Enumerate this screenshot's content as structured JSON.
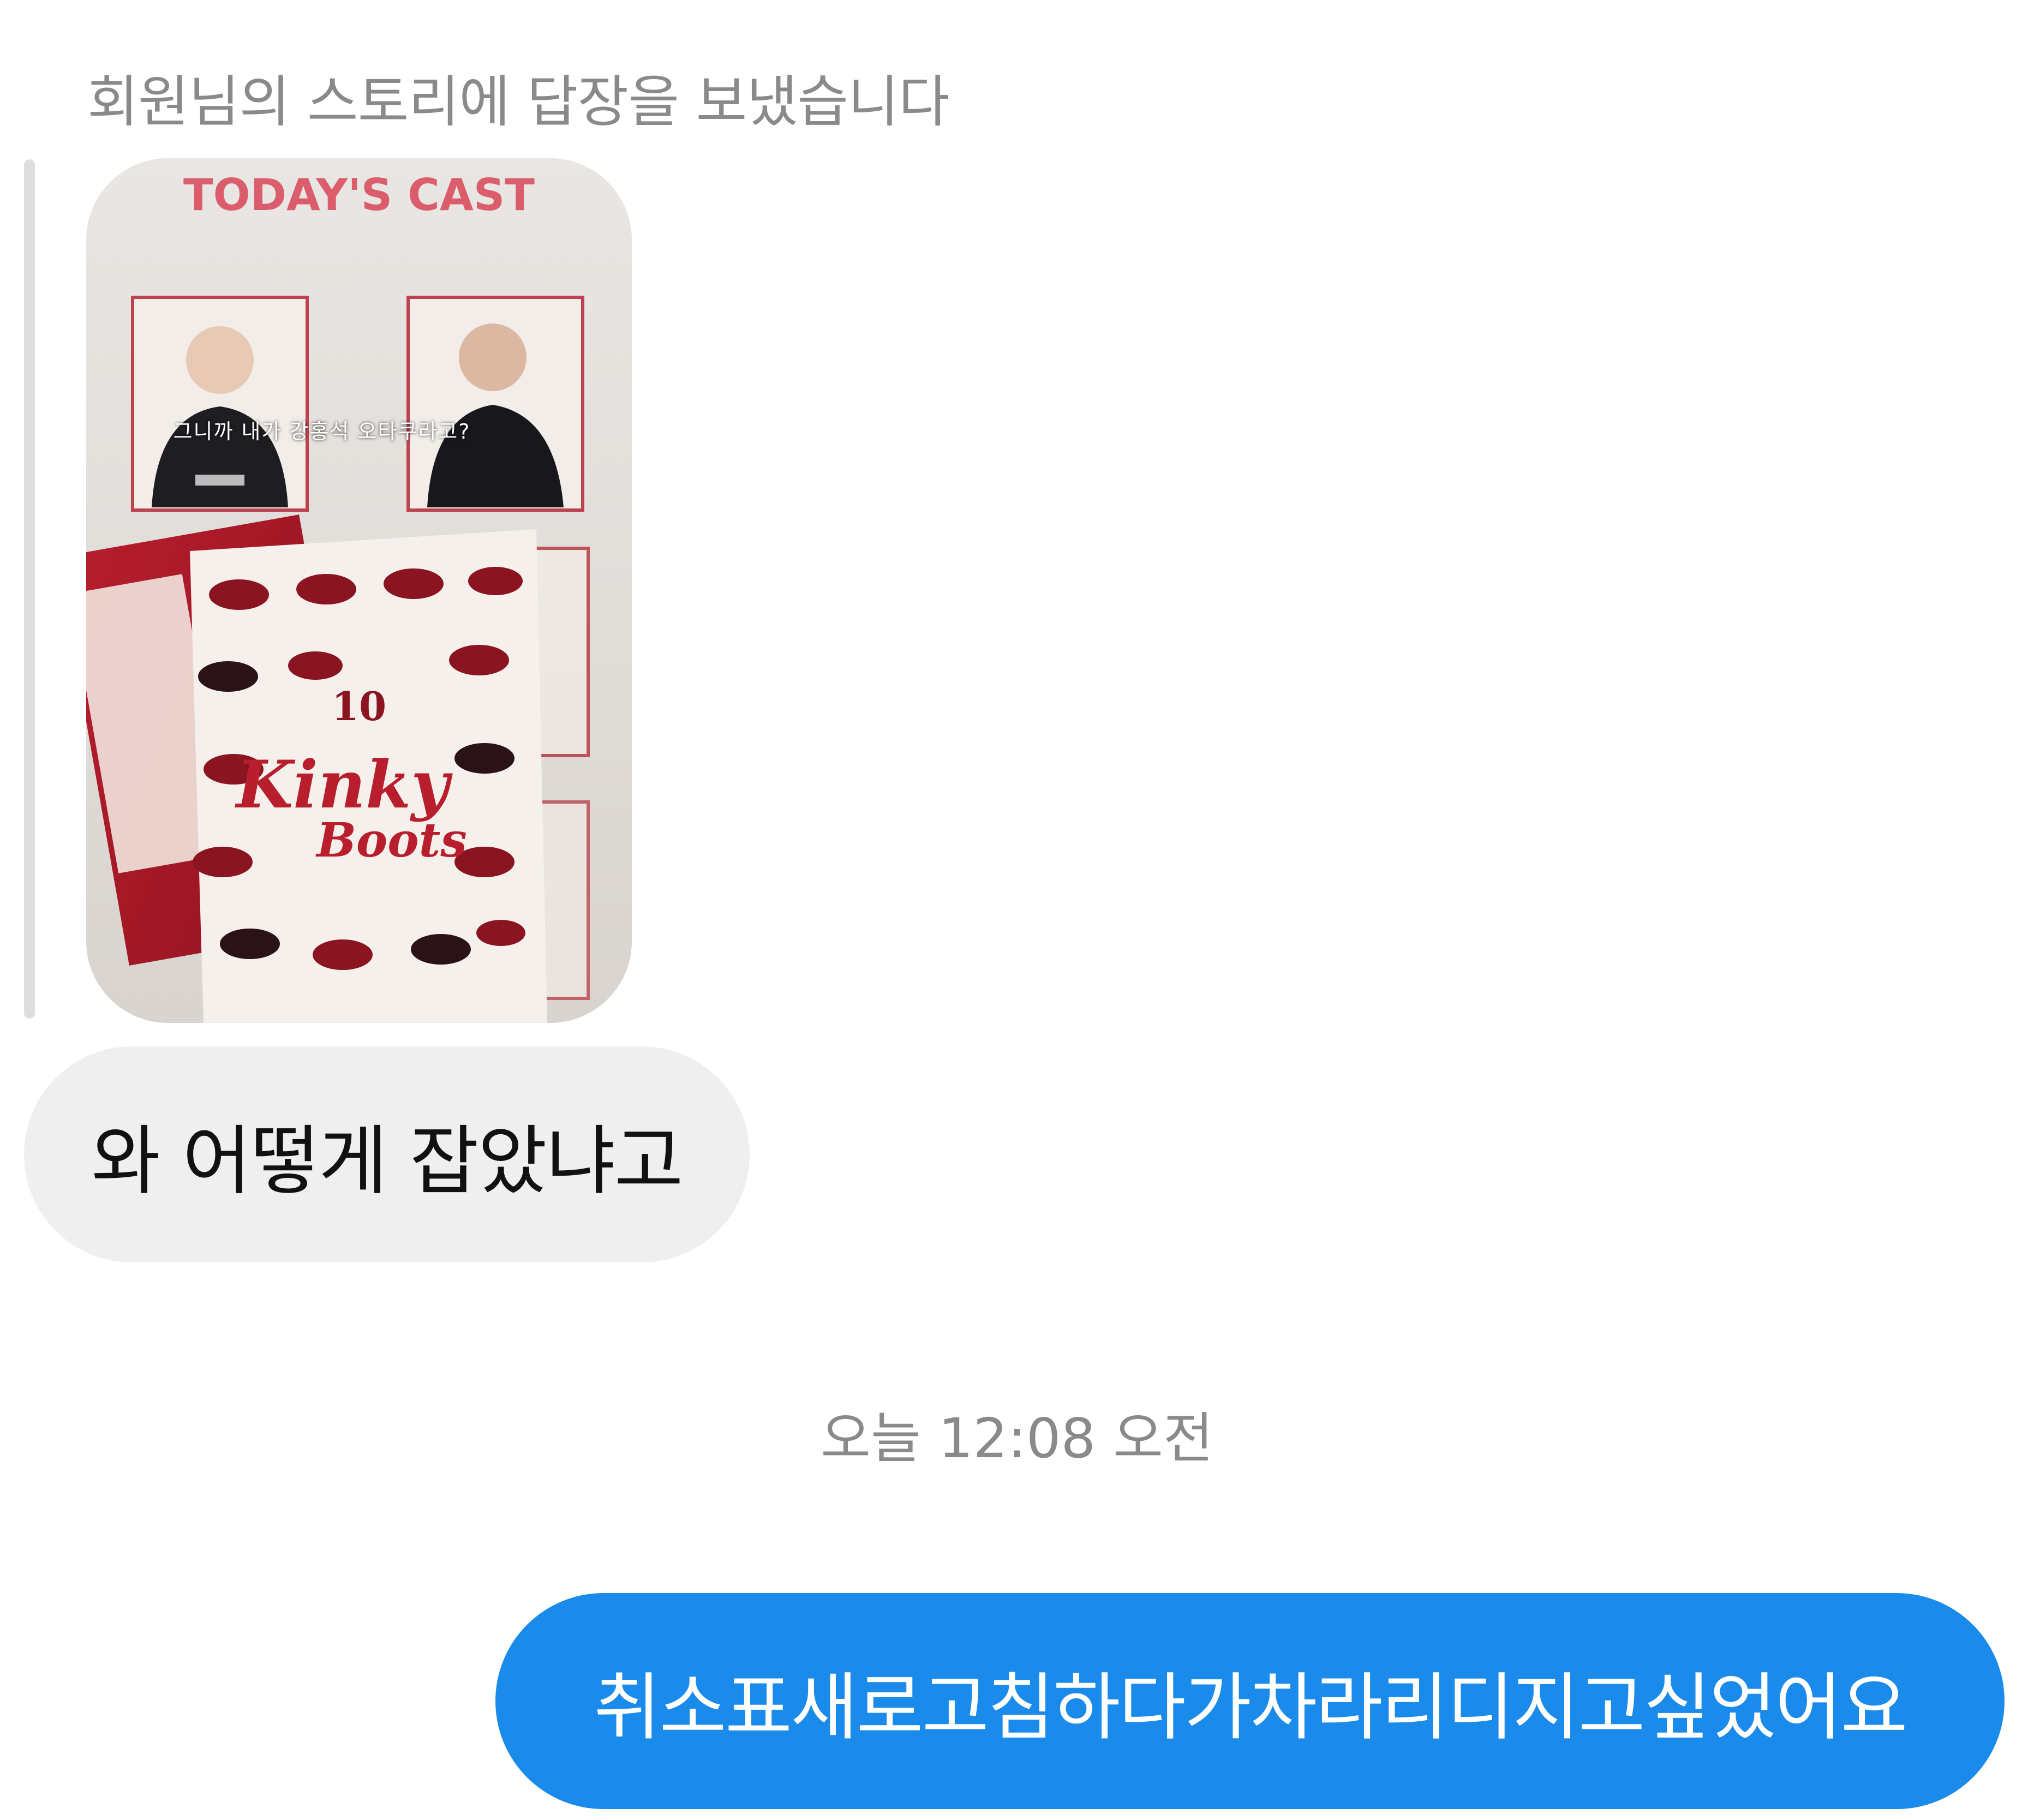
{
  "conversation": {
    "story_reply_label": "회원님의 스토리에 답장을 보냈습니다",
    "story_image": {
      "header_text": "TODAY'S CAST",
      "overlay_text": "그니까 내가 강홍석 오타쿠라고?",
      "program_number": "10",
      "program_title_top": "Kinky",
      "program_title_bottom": "Boots"
    },
    "incoming_message": "와 어떻게 잡았냐고",
    "timestamp": "오늘 12:08 오전",
    "outgoing_message": "취소표새로고침하다가차라리디지고싶었어요"
  },
  "colors": {
    "outgoing_bubble": "#1a8bea",
    "incoming_bubble": "#efefef",
    "muted_text": "#8a8a8a"
  }
}
